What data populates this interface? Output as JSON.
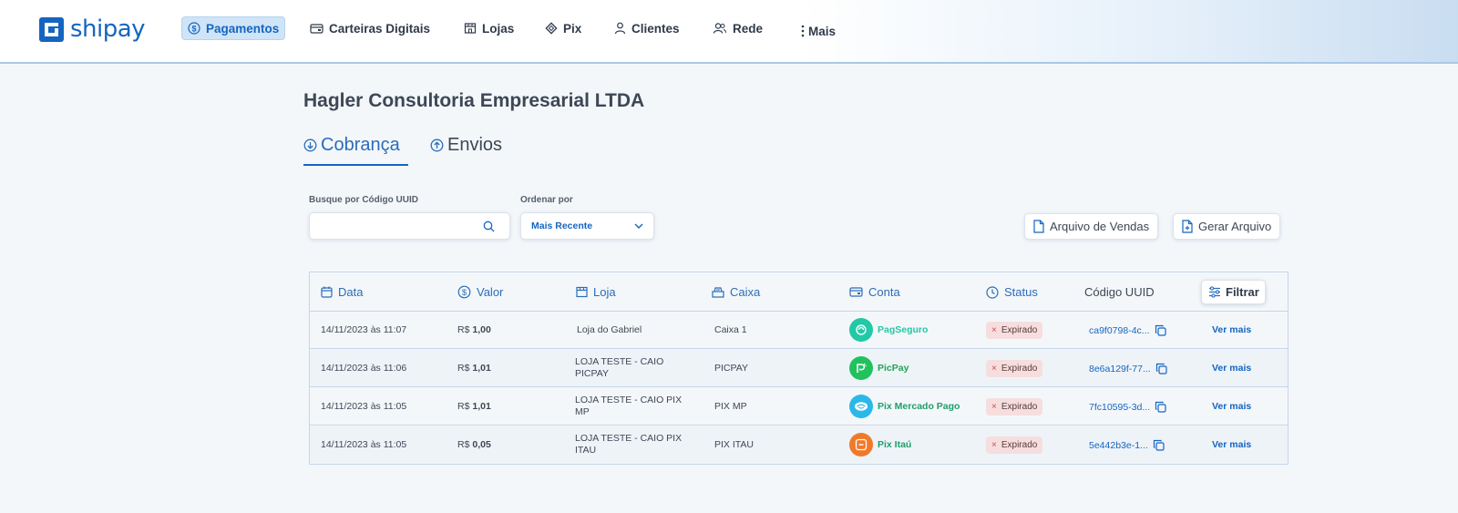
{
  "app": {
    "brand": "shipay"
  },
  "nav": {
    "items": [
      {
        "label": "Pagamentos",
        "icon": "dollar-circle-icon",
        "active": true
      },
      {
        "label": "Carteiras Digitais",
        "icon": "wallet-icon"
      },
      {
        "label": "Lojas",
        "icon": "store-icon"
      },
      {
        "label": "Pix",
        "icon": "pix-icon"
      },
      {
        "label": "Clientes",
        "icon": "user-icon"
      },
      {
        "label": "Rede",
        "icon": "users-icon"
      },
      {
        "label": "Mais",
        "icon": "more-vertical-icon"
      }
    ]
  },
  "page": {
    "title": "Hagler Consultoria Empresarial LTDA"
  },
  "tabs": [
    {
      "label": "Cobrança",
      "icon": "arrow-down-circle-icon",
      "active": true
    },
    {
      "label": "Envios",
      "icon": "arrow-up-circle-icon"
    }
  ],
  "filters": {
    "search_label": "Busque por Código UUID",
    "search_placeholder": "",
    "search_value": "",
    "order_label": "Ordenar por",
    "order_value": "Mais Recente"
  },
  "actions": {
    "sales_file": "Arquivo de Vendas",
    "generate_file": "Gerar Arquivo"
  },
  "table": {
    "headers": {
      "date": "Data",
      "value": "Valor",
      "store": "Loja",
      "register": "Caixa",
      "account": "Conta",
      "status": "Status",
      "uuid": "Código UUID",
      "filter": "Filtrar"
    },
    "rows": [
      {
        "date": "14/11/2023 às 11:07",
        "currency": "R$",
        "amount": "1,00",
        "store": "Loja do Gabriel",
        "register": "Caixa 1",
        "account": "PagSeguro",
        "account_color": "#22c9a6",
        "account_text_color": "#22c9a6",
        "status": "Expirado",
        "uuid": "ca9f0798-4c...",
        "more": "Ver mais"
      },
      {
        "date": "14/11/2023 às 11:06",
        "currency": "R$",
        "amount": "1,01",
        "store": "LOJA TESTE - CAIO PICPAY",
        "register": "PICPAY",
        "account": "PicPay",
        "account_color": "#21c25e",
        "account_text_color": "#21a553",
        "status": "Expirado",
        "uuid": "8e6a129f-77...",
        "more": "Ver mais"
      },
      {
        "date": "14/11/2023 às 11:05",
        "currency": "R$",
        "amount": "1,01",
        "store": "LOJA TESTE - CAIO PIX MP",
        "register": "PIX MP",
        "account": "Pix Mercado Pago",
        "account_color": "#2bb8e8",
        "account_text_color": "#1f9e6b",
        "status": "Expirado",
        "uuid": "7fc10595-3d...",
        "more": "Ver mais"
      },
      {
        "date": "14/11/2023 às 11:05",
        "currency": "R$",
        "amount": "0,05",
        "store": "LOJA TESTE - CAIO PIX ITAU",
        "register": "PIX ITAU",
        "account": "Pix Itaú",
        "account_color": "#f07a2a",
        "account_text_color": "#1f9e6b",
        "status": "Expirado",
        "uuid": "5e442b3e-1...",
        "more": "Ver mais"
      }
    ]
  }
}
